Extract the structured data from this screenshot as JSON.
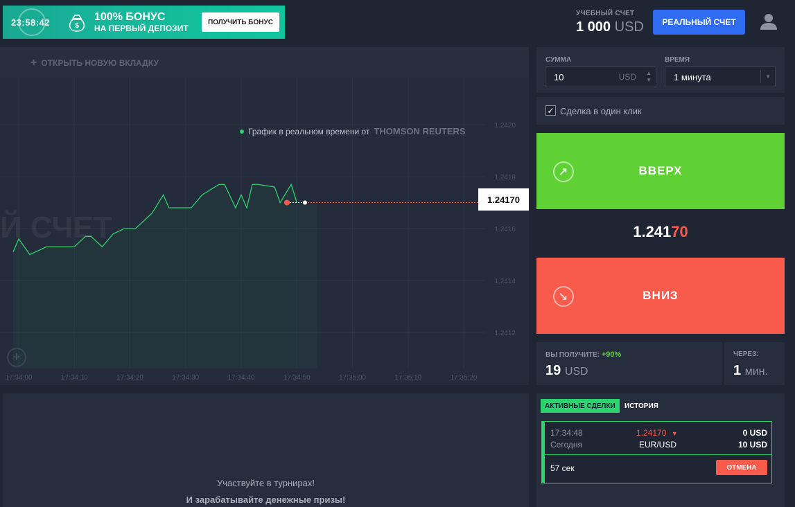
{
  "promo": {
    "timer": "23:58:42",
    "title": "100% БОНУС",
    "subtitle": "НА ПЕРВЫЙ ДЕПОЗИТ",
    "button": "ПОЛУЧИТЬ БОНУС"
  },
  "account": {
    "label": "УЧЕБНЫЙ СЧЕТ",
    "amount": "1 000",
    "currency": "USD",
    "real_button": "РЕАЛЬНЫЙ СЧЕТ"
  },
  "chart_panel": {
    "new_tab": "ОТКРЫТЬ НОВУЮ ВКЛАДКУ",
    "source_text": "График в реальном времени от",
    "source_brand": "THOMSON REUTERS",
    "watermark": "Й СЧЕТ",
    "current_price": "1.24170"
  },
  "chart_data": {
    "type": "line",
    "y_ticks": [
      "1.2420",
      "1.2418",
      "1.2416",
      "1.2414",
      "1.2412"
    ],
    "x_ticks": [
      "17:34:00",
      "17:34:10",
      "17:34:20",
      "17:34:30",
      "17:34:40",
      "17:34:50",
      "17:35:00",
      "17:35:10",
      "17:35:20"
    ],
    "ylim": [
      1.2411,
      1.2421
    ],
    "series": [
      {
        "x": [
          "17:33:59",
          "17:34:00",
          "17:34:02",
          "17:34:05",
          "17:34:07",
          "17:34:10",
          "17:34:12",
          "17:34:13",
          "17:34:15",
          "17:34:17",
          "17:34:19",
          "17:34:21",
          "17:34:24",
          "17:34:26",
          "17:34:27",
          "17:34:28",
          "17:34:29",
          "17:34:31",
          "17:34:33",
          "17:34:36",
          "17:34:37",
          "17:34:39",
          "17:34:40",
          "17:34:41",
          "17:34:42",
          "17:34:43",
          "17:34:46",
          "17:34:47",
          "17:34:49",
          "17:34:50"
        ],
        "y": [
          1.24151,
          1.24156,
          1.2415,
          1.24153,
          1.24153,
          1.24153,
          1.24157,
          1.24157,
          1.24153,
          1.24158,
          1.2416,
          1.2416,
          1.24166,
          1.24173,
          1.24168,
          1.24168,
          1.24168,
          1.24168,
          1.24173,
          1.24177,
          1.24177,
          1.24168,
          1.24173,
          1.24168,
          1.24177,
          1.24177,
          1.24176,
          1.2417,
          1.24177,
          1.2417
        ]
      }
    ],
    "grid": true
  },
  "zoom_icon": "plus-circle-icon",
  "tournament": {
    "line1": "Участвуйте в турнирах!",
    "line2": "И зарабатывайте денежные призы!"
  },
  "trade": {
    "sum_label": "СУММА",
    "sum_value": "10",
    "sum_currency": "USD",
    "time_label": "ВРЕМЯ",
    "time_value": "1 минута",
    "one_click": "Сделка в один клик",
    "one_click_checked": true,
    "up_label": "ВВЕРХ",
    "down_label": "ВНИЗ",
    "price_main": "1.241",
    "price_tail": "70",
    "payout_label": "ВЫ ПОЛУЧИТЕ:",
    "payout_pct": "+90%",
    "payout_value": "19",
    "payout_cur": "USD",
    "expire_label": "ЧЕРЕЗ:",
    "expire_value": "1",
    "expire_unit": "мин."
  },
  "deals": {
    "tab_active": "АКТИВНЫЕ СДЕЛКИ",
    "tab_history": "ИСТОРИЯ",
    "time": "17:34:48",
    "day": "Сегодня",
    "price": "1.24170",
    "pair": "EUR/USD",
    "profit": "0 USD",
    "amount": "10 USD",
    "remaining": "57 сек",
    "cancel": "ОТМЕНА"
  },
  "colors": {
    "up": "#5fd135",
    "down": "#f85a4b",
    "accent": "#2f6cf2",
    "line": "#2bd26e"
  }
}
